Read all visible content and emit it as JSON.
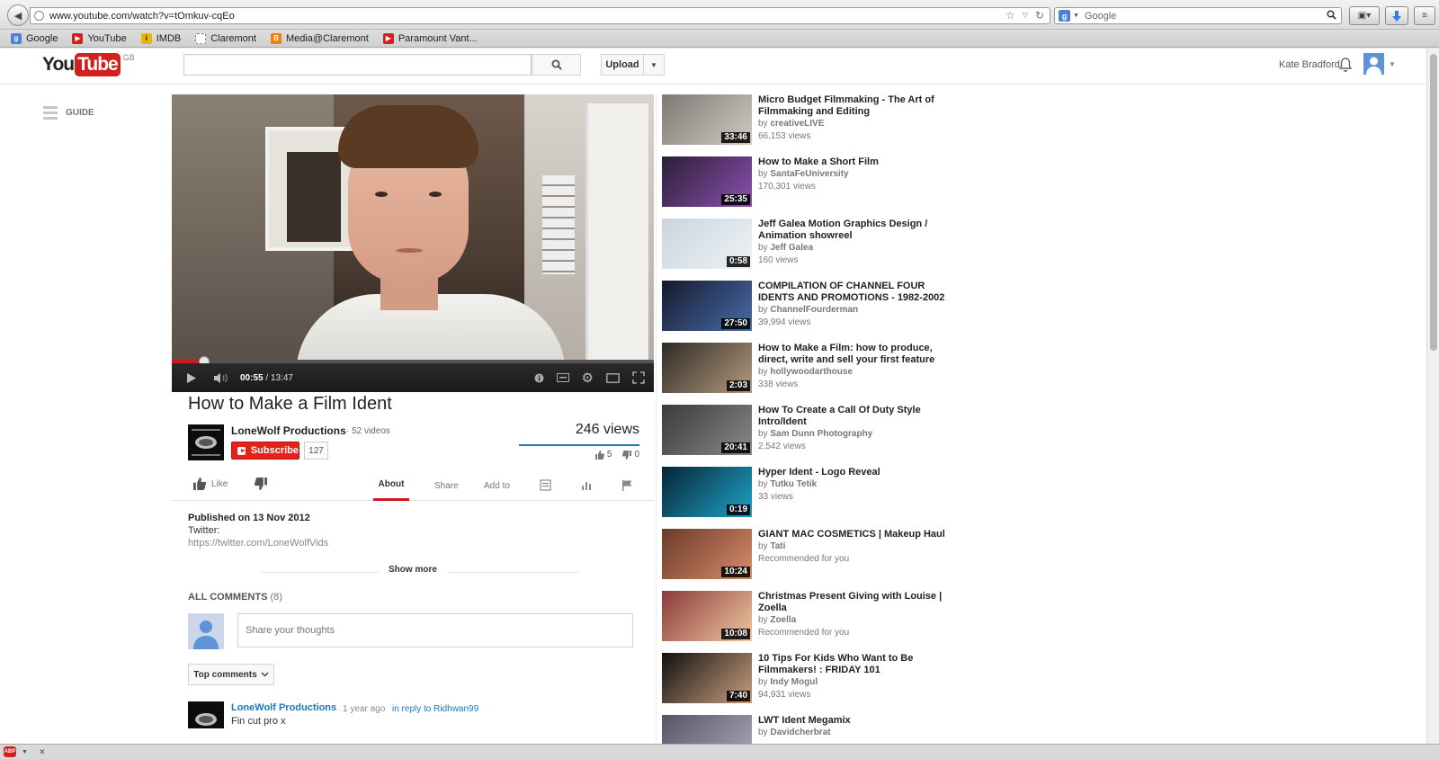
{
  "browser": {
    "url": "www.youtube.com/watch?v=tOmkuv-cqEo",
    "search_engine_placeholder": "Google",
    "bookmarks": [
      {
        "label": "Google",
        "icon": "google-icon",
        "color": "#4f7fd8",
        "glyph": "g"
      },
      {
        "label": "YouTube",
        "icon": "youtube-icon",
        "color": "#d2201b",
        "glyph": "▶"
      },
      {
        "label": "IMDB",
        "icon": "imdb-icon",
        "color": "#e6b800",
        "glyph": "i"
      },
      {
        "label": "Claremont",
        "icon": "page-icon",
        "color": "#ffffff",
        "glyph": ""
      },
      {
        "label": "Media@Claremont",
        "icon": "blogger-icon",
        "color": "#f57d00",
        "glyph": "B"
      },
      {
        "label": "Paramount Vant...",
        "icon": "youtube-icon",
        "color": "#d2201b",
        "glyph": "▶"
      }
    ]
  },
  "masthead": {
    "logo_you": "You",
    "logo_tube": "Tube",
    "logo_region": "GB",
    "search_placeholder": "",
    "upload_label": "Upload",
    "user_name": "Kate Bradford"
  },
  "guide": {
    "label": "GUIDE"
  },
  "player": {
    "current_time": "00:55",
    "total_time": "13:47",
    "progress_fraction": 0.0666
  },
  "video": {
    "title": "How to Make a Film Ident",
    "channel": "LoneWolf Productions",
    "channel_videos": "52 videos",
    "subscribe_label": "Subscribe",
    "subscriber_count": "127",
    "views": "246 views",
    "likes": "5",
    "dislikes": "0"
  },
  "actions": {
    "like_label": "Like",
    "about_label": "About",
    "share_label": "Share",
    "addto_label": "Add to"
  },
  "description": {
    "published": "Published on 13 Nov 2012",
    "line1": "Twitter:",
    "link": "https://twitter.com/LoneWolfVids",
    "show_more": "Show more"
  },
  "comments": {
    "header": "ALL COMMENTS",
    "count": "(8)",
    "input_placeholder": "Share your thoughts",
    "sort_label": "Top comments",
    "first": {
      "author": "LoneWolf Productions",
      "time": "1 year ago",
      "reply_to": "in reply to Ridhwan99",
      "text": "Fin cut pro x"
    }
  },
  "related": [
    {
      "title": "Micro Budget Filmmaking - The Art of Filmmaking and Editing",
      "by": "creativeLIVE",
      "views": "66,153 views",
      "duration": "33:46",
      "thumb": "#7d7a74",
      "thumb2": "#cfcac0"
    },
    {
      "title": "How to Make a Short Film",
      "by": "SantaFeUniversity",
      "views": "170,301 views",
      "duration": "25:35",
      "thumb": "#2a1f36",
      "thumb2": "#8e4fb0"
    },
    {
      "title": "Jeff Galea Motion Graphics Design / Animation showreel",
      "by": "Jeff Galea",
      "views": "160 views",
      "duration": "0:58",
      "thumb": "#c9d5de",
      "thumb2": "#eef3f6"
    },
    {
      "title": "COMPILATION OF CHANNEL FOUR IDENTS AND PROMOTIONS - 1982-2002",
      "by": "ChannelFourderman",
      "views": "39,994 views",
      "duration": "27:50",
      "thumb": "#141a2e",
      "thumb2": "#4a6ca8"
    },
    {
      "title": "How to Make a Film: how to produce, direct, write and sell your first feature",
      "by": "hollywoodarthouse",
      "views": "338 views",
      "duration": "2:03",
      "thumb": "#2e2a26",
      "thumb2": "#b49a7e"
    },
    {
      "title": "How To Create a Call Of Duty Style Intro/Ident",
      "by": "Sam Dunn Photography",
      "views": "2,542 views",
      "duration": "20:41",
      "thumb": "#3a3a3a",
      "thumb2": "#8a8a8a"
    },
    {
      "title": "Hyper Ident - Logo Reveal",
      "by": "Tutku Tetik",
      "views": "33 views",
      "duration": "0:19",
      "thumb": "#062536",
      "thumb2": "#1fa2c8"
    },
    {
      "title": "GIANT MAC COSMETICS | Makeup Haul",
      "by": "Tati",
      "views": "Recommended for you",
      "duration": "10:24",
      "thumb": "#6a3b2a",
      "thumb2": "#d98c6a"
    },
    {
      "title": "Christmas Present Giving with Louise | Zoella",
      "by": "Zoella",
      "views": "Recommended for you",
      "duration": "10:08",
      "thumb": "#8a3a3a",
      "thumb2": "#f0c8a0"
    },
    {
      "title": "10 Tips For Kids Who Want to Be Filmmakers! : FRIDAY 101",
      "by": "Indy Mogul",
      "views": "94,931 views",
      "duration": "7:40",
      "thumb": "#111111",
      "thumb2": "#c8a080"
    },
    {
      "title": "LWT Ident Megamix",
      "by": "Davidcherbrat",
      "views": "",
      "duration": "",
      "thumb": "#556",
      "thumb2": "#aab"
    }
  ],
  "colors": {
    "brand_red": "#cc181e",
    "link_blue": "#167ac6"
  }
}
